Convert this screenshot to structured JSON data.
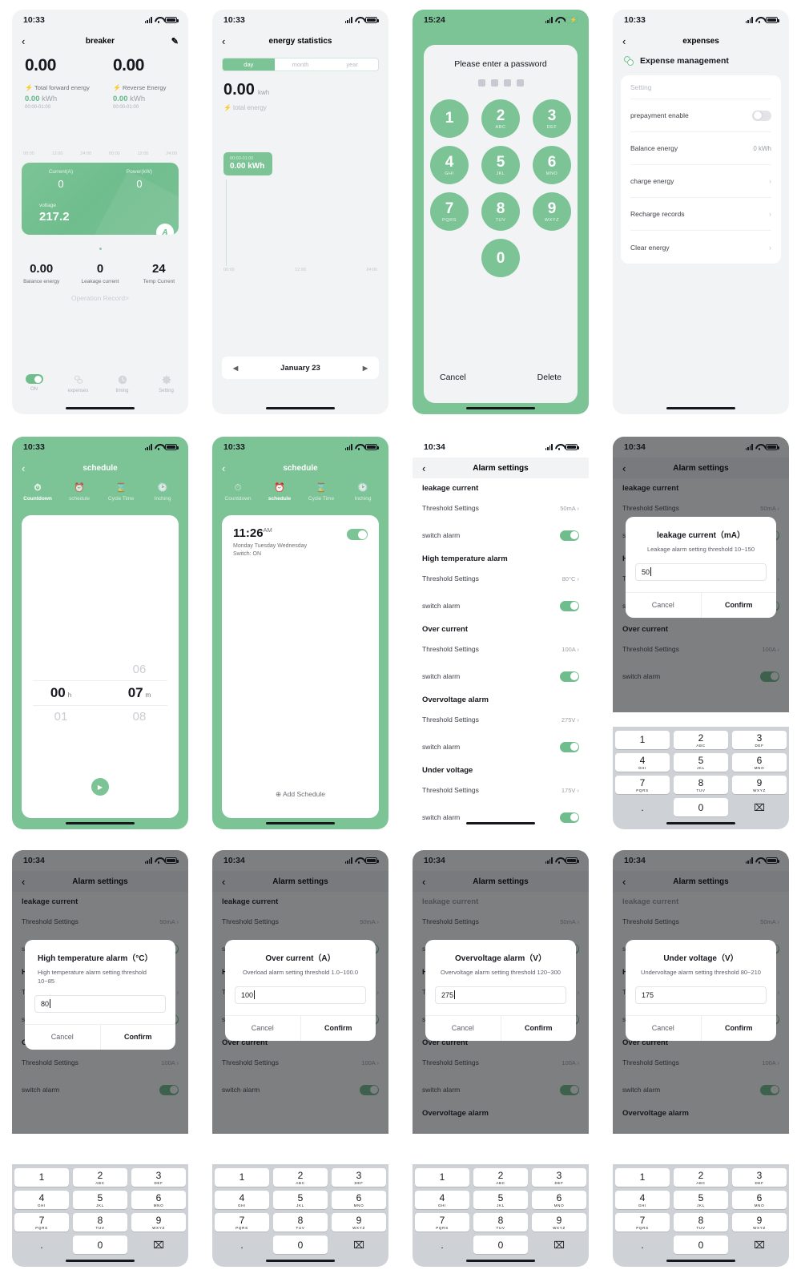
{
  "panels": {
    "breaker": {
      "time": "10:33",
      "title": "breaker",
      "edit_icon": "pencil-icon",
      "forward": {
        "value": "0.00",
        "label": "Total forward energy",
        "kwh": "0.00",
        "unit": "kWh",
        "range": "00:00-01:00"
      },
      "reverse": {
        "value": "0.00",
        "label": "Reverse Energy",
        "kwh": "0.00",
        "unit": "kWh",
        "range": "00:00-01:00"
      },
      "axis": [
        "00:00",
        "12:00",
        "24:00",
        "00:00",
        "12:00",
        "24:00"
      ],
      "current": {
        "label": "Current(A)",
        "value": "0"
      },
      "power": {
        "label": "Power(kW)",
        "value": "0"
      },
      "voltage": {
        "label": "voltage",
        "value": "217.2"
      },
      "badge": "A",
      "metrics": [
        {
          "value": "0.00",
          "label": "Balance energy"
        },
        {
          "value": "0",
          "label": "Leakage current"
        },
        {
          "value": "24",
          "label": "Temp Current"
        }
      ],
      "operation_record": "Operation Record>",
      "tabs": [
        {
          "label": "ON",
          "icon": "toggle-on-icon"
        },
        {
          "label": "expenses",
          "icon": "coins-icon"
        },
        {
          "label": "timing",
          "icon": "clock-icon"
        },
        {
          "label": "Setting",
          "icon": "gear-icon"
        }
      ]
    },
    "energy": {
      "time": "10:33",
      "title": "energy statistics",
      "segments": [
        "day",
        "month",
        "year"
      ],
      "selected_segment": "day",
      "total": "0.00",
      "total_unit": "kwh",
      "total_label": "total energy",
      "tooltip_time": "00:00-01:00",
      "tooltip_value": "0.00 kWh",
      "axis": [
        "00:00",
        "12:00",
        "24:00"
      ],
      "date": "January 23",
      "prev_icon": "chevron-left-icon",
      "next_icon": "chevron-right-icon"
    },
    "password": {
      "time": "15:24",
      "prompt": "Please enter a password",
      "dots": 4,
      "keys": [
        {
          "n": "1",
          "s": ""
        },
        {
          "n": "2",
          "s": "ABC"
        },
        {
          "n": "3",
          "s": "DEF"
        },
        {
          "n": "4",
          "s": "GHI"
        },
        {
          "n": "5",
          "s": "JKL"
        },
        {
          "n": "6",
          "s": "MNO"
        },
        {
          "n": "7",
          "s": "PQRS"
        },
        {
          "n": "8",
          "s": "TUV"
        },
        {
          "n": "9",
          "s": "WXYZ"
        },
        {
          "n": "0",
          "s": ""
        }
      ],
      "cancel": "Cancel",
      "delete": "Delete"
    },
    "expenses": {
      "time": "10:33",
      "title": "expenses",
      "heading": "Expense management",
      "section": "Setting",
      "rows": [
        {
          "label": "prepayment enable",
          "type": "toggle",
          "value": "off"
        },
        {
          "label": "Balance energy",
          "type": "value",
          "value": "0 kWh"
        },
        {
          "label": "charge energy",
          "type": "chevron",
          "value": "›"
        },
        {
          "label": "Recharge records",
          "type": "chevron",
          "value": "›"
        },
        {
          "label": "Clear energy",
          "type": "chevron",
          "value": "›"
        }
      ]
    },
    "schedule_countdown": {
      "time": "10:33",
      "title": "schedule",
      "tabs": [
        {
          "label": "Countdown",
          "icon": "clock-icon"
        },
        {
          "label": "schedule",
          "icon": "alarm-icon"
        },
        {
          "label": "Cycle Time",
          "icon": "hourglass-icon"
        },
        {
          "label": "Inching",
          "icon": "timer-icon"
        }
      ],
      "active_tab": "Countdown",
      "hours": {
        "above": "",
        "selected": "00",
        "below": "01",
        "unit": "h"
      },
      "minutes": {
        "above": "06",
        "selected": "07",
        "below": "08",
        "unit": "m"
      },
      "play_icon": "play-icon"
    },
    "schedule_list": {
      "time": "10:33",
      "title": "schedule",
      "tabs": [
        {
          "label": "Countdown",
          "icon": "clock-icon"
        },
        {
          "label": "schedule",
          "icon": "alarm-icon"
        },
        {
          "label": "Cycle Time",
          "icon": "hourglass-icon"
        },
        {
          "label": "Inching",
          "icon": "timer-icon"
        }
      ],
      "active_tab": "schedule",
      "item": {
        "time": "11:26",
        "meridiem": "AM",
        "days": "Monday Tuesday Wednesday",
        "switch": "Switch: ON",
        "enabled": true
      },
      "add": "⊕ Add Schedule"
    },
    "alarm_settings": {
      "time": "10:34",
      "title": "Alarm settings",
      "threshold_label": "Threshold Settings",
      "switch_label": "switch alarm",
      "sections": [
        {
          "name": "leakage current",
          "threshold": "50mA",
          "switch": true
        },
        {
          "name": "High temperature alarm",
          "threshold": "80°C",
          "switch": true
        },
        {
          "name": "Over current",
          "threshold": "100A",
          "switch": true
        },
        {
          "name": "Overvoltage alarm",
          "threshold": "275V",
          "switch": true
        },
        {
          "name": "Under voltage",
          "threshold": "175V",
          "switch": true
        }
      ]
    },
    "dialogs": {
      "cancel": "Cancel",
      "confirm": "Confirm",
      "leakage": {
        "title": "leakage current（mA）",
        "desc": "Leakage alarm setting threshold 10~150",
        "value": "50"
      },
      "high_temp": {
        "title": "High temperature alarm（°C）",
        "desc": "High temperature alarm setting threshold 10~85",
        "value": "80"
      },
      "over_current": {
        "title": "Over current（A）",
        "desc": "Overload alarm setting threshold 1.0~100.0",
        "value": "100"
      },
      "overvoltage": {
        "title": "Overvoltage alarm（V）",
        "desc": "Overvoltage alarm setting threshold 120~300",
        "value": "275"
      },
      "undervoltage": {
        "title": "Under voltage（V）",
        "desc": "Undervoltage alarm setting threshold 80~210",
        "value": "175"
      }
    },
    "numpad": {
      "keys": [
        {
          "n": "1",
          "s": ""
        },
        {
          "n": "2",
          "s": "ABC"
        },
        {
          "n": "3",
          "s": "DEF"
        },
        {
          "n": "4",
          "s": "GHI"
        },
        {
          "n": "5",
          "s": "JKL"
        },
        {
          "n": "6",
          "s": "MNO"
        },
        {
          "n": "7",
          "s": "PQRS"
        },
        {
          "n": "8",
          "s": "TUV"
        },
        {
          "n": "9",
          "s": "WXYZ"
        },
        {
          "n": ".",
          "s": ""
        },
        {
          "n": "0",
          "s": ""
        },
        {
          "n": "⌧",
          "s": ""
        }
      ]
    }
  },
  "colors": {
    "brand_green": "#7cc496",
    "page_bg": "#f2f3f5",
    "accent_yellow": "#f5c518",
    "text_dark": "#16181d"
  }
}
